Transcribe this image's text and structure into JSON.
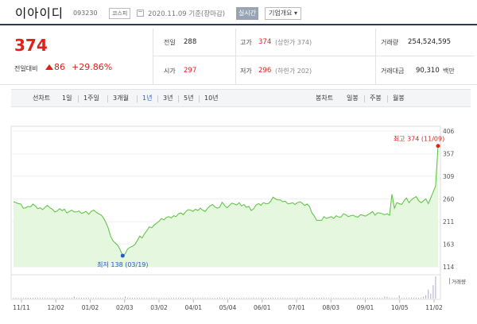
{
  "header": {
    "name": "이아이디",
    "code": "093230",
    "market_badge": "코스피",
    "date": "2020.11.09 기준(장마감)",
    "realtime_button": "실시간",
    "company_button": "기업개요"
  },
  "summary": {
    "price": "374",
    "change_label": "전일대비",
    "change_value": "86",
    "change_pct": "+29.86%",
    "prev_close_label": "전일",
    "prev_close": "288",
    "open_label": "시가",
    "open": "297",
    "high_label": "고가",
    "high": "374",
    "upper_limit": "(상한가 374)",
    "low_label": "저가",
    "low": "296",
    "lower_limit": "(하한가 202)",
    "volume_label": "거래량",
    "volume": "254,524,595",
    "amount_label": "거래대금",
    "amount": "90,310",
    "amount_unit": "백만"
  },
  "tabs": {
    "line_label": "선차트",
    "line_periods": [
      "1일",
      "1주일",
      "3개월",
      "1년",
      "3년",
      "5년",
      "10년"
    ],
    "active_period": "1년",
    "candle_label": "봉차트",
    "candle_periods": [
      "일봉",
      "주봉",
      "월봉"
    ]
  },
  "colors": {
    "up": "#e0201b",
    "active": "#2759c4",
    "line": "#56c23b",
    "area": "#e6f7df",
    "volume": "#9a94c9"
  },
  "chart_data": {
    "type": "area",
    "y_ticks": [
      406,
      357,
      309,
      260,
      211,
      163,
      114
    ],
    "ylim": [
      114,
      406
    ],
    "x_tick_labels": [
      "11/11",
      "12/02",
      "01/02",
      "02/03",
      "03/02",
      "04/01",
      "05/04",
      "06/01",
      "07/01",
      "08/03",
      "09/01",
      "10/05",
      "11/02"
    ],
    "max_label": "최고 374 (11/09)",
    "min_label": "최저 138 (03/19)",
    "volume_label": "거래량",
    "series": [
      {
        "values": [
          254,
          252,
          250,
          249,
          240,
          241,
          244,
          243,
          249,
          245,
          239,
          241,
          237,
          242,
          246,
          241,
          238,
          232,
          234,
          239,
          235,
          238,
          230,
          233,
          236,
          232,
          232,
          234,
          229,
          231,
          233,
          227,
          233,
          236,
          232,
          228,
          226,
          220,
          210,
          198,
          180,
          170,
          165,
          160,
          150,
          138,
          142,
          152,
          156,
          158,
          162,
          170,
          180,
          176,
          185,
          192,
          200,
          198,
          204,
          208,
          212,
          218,
          215,
          220,
          222,
          219,
          224,
          222,
          228,
          230,
          226,
          233,
          237,
          236,
          233,
          238,
          235,
          240,
          236,
          233,
          240,
          245,
          248,
          243,
          240,
          242,
          253,
          246,
          241,
          246,
          251,
          249,
          247,
          252,
          245,
          248,
          242,
          244,
          235,
          239,
          247,
          250,
          246,
          252,
          250,
          250,
          255,
          264,
          260,
          258,
          258,
          254,
          255,
          250,
          250,
          252,
          248,
          252,
          254,
          251,
          246,
          249,
          244,
          230,
          223,
          214,
          214,
          214,
          222,
          218,
          220,
          222,
          218,
          224,
          221,
          221,
          228,
          226,
          222,
          224,
          225,
          222,
          221,
          226,
          225,
          223,
          226,
          229,
          233,
          225,
          230,
          230,
          228,
          226,
          228,
          225,
          270,
          240,
          252,
          250,
          248,
          256,
          262,
          252,
          258,
          262,
          265,
          256,
          252,
          256,
          260,
          250,
          262,
          275,
          288,
          374
        ]
      }
    ],
    "volume": [
      1,
      2,
      1,
      1,
      3,
      2,
      1,
      1,
      2,
      1,
      1,
      2,
      1,
      1,
      1,
      2,
      1,
      1,
      3,
      1,
      1,
      1,
      2,
      1,
      1,
      9,
      2,
      1,
      1,
      1,
      2,
      1,
      1,
      1,
      2,
      1,
      4,
      2,
      1,
      1,
      2,
      1,
      1,
      3,
      1,
      2,
      10,
      3,
      2,
      1,
      1,
      2,
      1,
      1,
      3,
      1,
      1,
      1,
      2,
      1,
      1,
      1,
      2,
      1,
      1,
      2,
      1,
      1,
      3,
      1,
      1,
      2,
      1,
      1,
      1,
      2,
      1,
      1,
      4,
      2,
      1,
      1,
      2,
      1,
      1,
      5,
      2,
      1,
      1,
      3,
      1,
      1,
      2,
      1,
      1,
      1,
      2,
      1,
      1,
      5,
      3,
      2,
      1,
      1,
      1,
      2,
      1,
      1,
      2,
      1,
      1,
      4,
      2,
      1,
      1,
      2,
      1,
      1,
      1,
      5,
      2,
      1,
      1,
      2,
      1,
      1,
      1,
      2,
      1,
      1,
      1,
      2,
      1,
      3,
      1,
      1,
      1,
      2,
      1,
      1,
      1,
      2,
      1,
      2,
      1,
      1,
      3,
      1,
      1,
      2,
      1,
      1,
      1,
      9,
      8,
      4,
      3,
      2,
      2,
      14,
      3,
      2,
      2,
      2,
      5,
      2,
      2,
      3,
      2,
      8,
      16,
      40,
      22,
      60,
      100
    ]
  }
}
